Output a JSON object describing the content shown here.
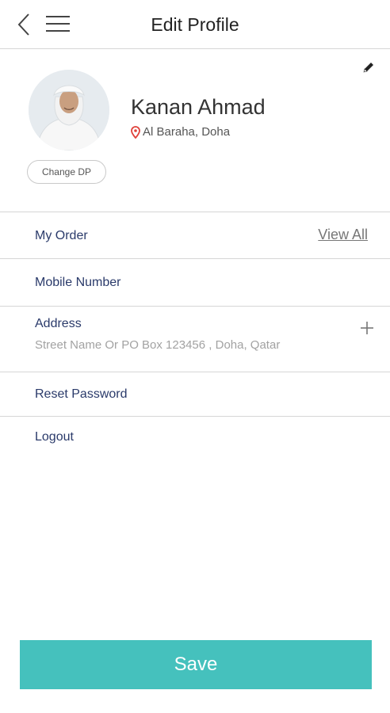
{
  "header": {
    "title": "Edit Profile",
    "back_icon": "chevron-left-icon",
    "menu_icon": "hamburger-menu-icon"
  },
  "profile": {
    "name": "Kanan Ahmad",
    "location": "Al Baraha, Doha",
    "change_dp_label": "Change DP",
    "edit_icon": "pencil-icon",
    "location_icon": "map-pin-icon"
  },
  "menu": {
    "my_order": {
      "label": "My Order",
      "link": "View All"
    },
    "mobile_number": {
      "label": "Mobile Number"
    },
    "address": {
      "label": "Address",
      "value": "Street Name Or PO Box 123456 , Doha, Qatar",
      "add_icon": "plus-icon"
    },
    "reset_password": {
      "label": "Reset Password"
    },
    "logout": {
      "label": "Logout"
    }
  },
  "footer": {
    "save_label": "Save"
  },
  "colors": {
    "accent": "#45c1bd",
    "label": "#2a3a6a",
    "location_pin": "#e0413a"
  }
}
